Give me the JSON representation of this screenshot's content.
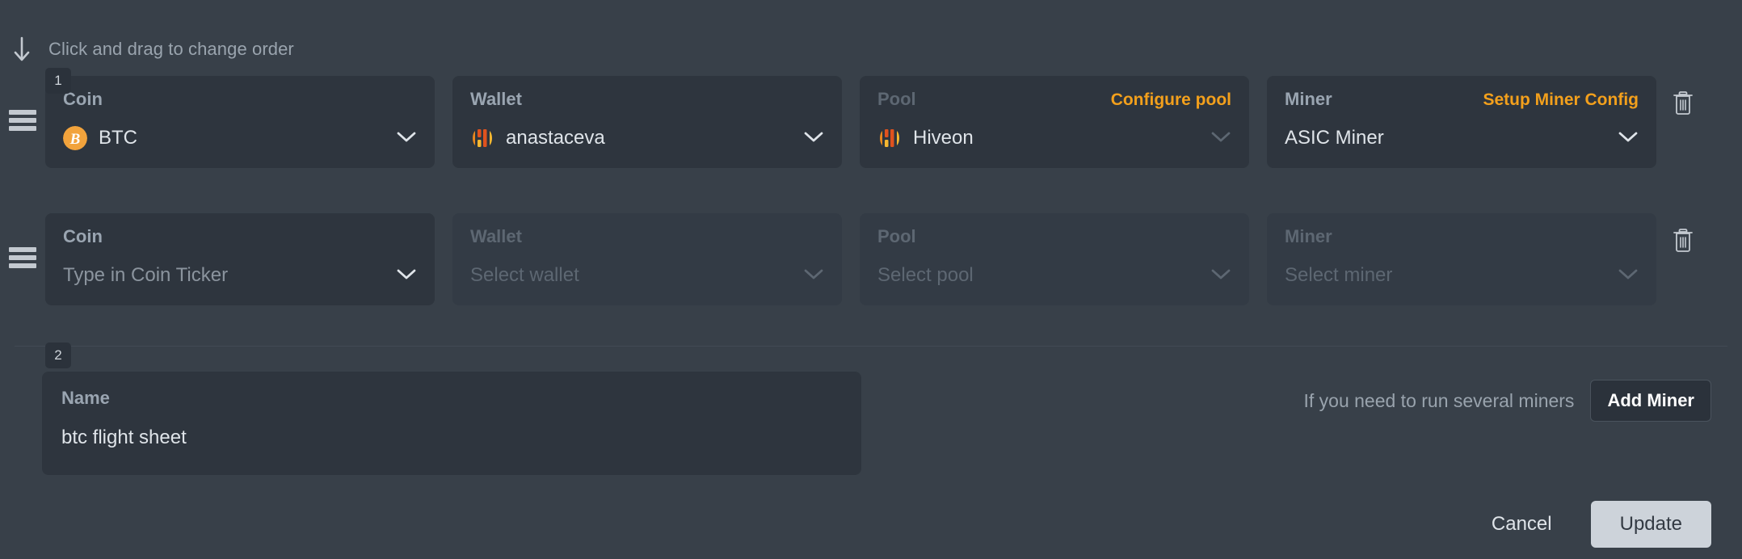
{
  "hint": {
    "arrow_icon": "arrow-down-icon",
    "text": "Click and drag to change order"
  },
  "colors": {
    "accent": "#f3a01c",
    "page_bg": "#384049",
    "field_bg": "#2e353e",
    "field_bg_disabled": "#333b45",
    "text": "#dfe4e9",
    "label": "#9aa5b1",
    "label_dim": "#5d6772",
    "update_button_bg": "#cdd3da"
  },
  "rows": [
    {
      "number": "1",
      "drag_handle_icon": "drag-handle-icon",
      "delete_icon": "trash-icon",
      "fields": [
        {
          "name": "coin",
          "label": "Coin",
          "value": "BTC",
          "icon": "bitcoin-icon",
          "action": null,
          "disabled": false,
          "is_placeholder": false
        },
        {
          "name": "wallet",
          "label": "Wallet",
          "value": "anastaceva",
          "icon": "hiveon-icon",
          "action": null,
          "disabled": false,
          "is_placeholder": false
        },
        {
          "name": "pool",
          "label": "Pool",
          "value": "Hiveon",
          "icon": "hiveon-icon",
          "action": "Configure pool",
          "disabled": false,
          "label_dim": true,
          "is_placeholder": false
        },
        {
          "name": "miner",
          "label": "Miner",
          "value": "ASIC Miner",
          "icon": null,
          "action": "Setup Miner Config",
          "disabled": false,
          "is_placeholder": false
        }
      ]
    },
    {
      "number": "2",
      "drag_handle_icon": "drag-handle-icon",
      "delete_icon": "trash-icon",
      "fields": [
        {
          "name": "coin",
          "label": "Coin",
          "value": "Type in Coin Ticker",
          "icon": null,
          "action": null,
          "disabled": false,
          "is_placeholder": true
        },
        {
          "name": "wallet",
          "label": "Wallet",
          "value": "Select wallet",
          "icon": null,
          "action": null,
          "disabled": true,
          "is_placeholder": true
        },
        {
          "name": "pool",
          "label": "Pool",
          "value": "Select pool",
          "icon": null,
          "action": null,
          "disabled": true,
          "is_placeholder": true
        },
        {
          "name": "miner",
          "label": "Miner",
          "value": "Select miner",
          "icon": null,
          "action": null,
          "disabled": true,
          "is_placeholder": true
        }
      ]
    }
  ],
  "name_field": {
    "label": "Name",
    "value": "btc flight sheet"
  },
  "add_miner": {
    "hint": "If you need to run several miners",
    "button_label": "Add Miner"
  },
  "footer": {
    "cancel_label": "Cancel",
    "update_label": "Update"
  }
}
